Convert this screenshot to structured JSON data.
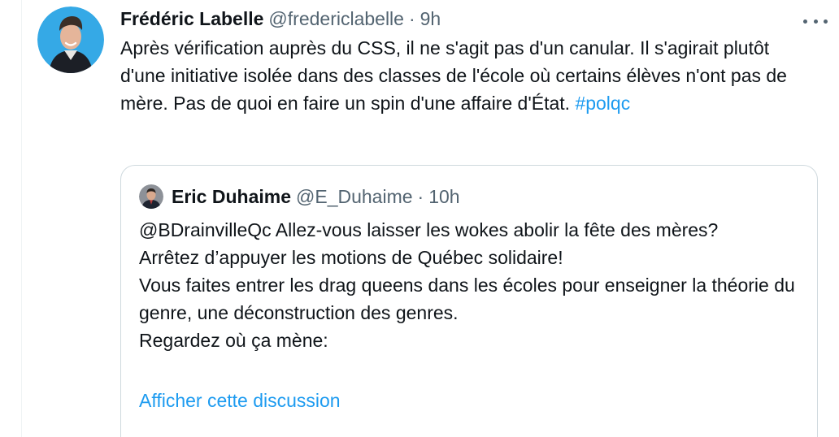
{
  "tweet": {
    "author_name": "Frédéric Labelle",
    "author_handle": "@fredericlabelle",
    "separator": "·",
    "timestamp": "9h",
    "text": "Après vérification auprès du CSS, il ne s'agit pas d'un canular. Il s'agirait plutôt d'une initiative isolée dans des classes de l'école où certains élèves n'ont pas de mère. Pas de quoi en faire un spin d'une affaire d'État.",
    "hashtag": "#polqc",
    "more_icon": "more-horizontal-icon"
  },
  "quoted_tweet": {
    "author_name": "Eric Duhaime",
    "author_handle": "@E_Duhaime",
    "separator": "·",
    "timestamp": "10h",
    "lines": [
      "@BDrainvilleQc Allez-vous laisser les wokes abolir la fête des mères?",
      "Arrêtez d’appuyer les motions de Québec solidaire!",
      "Vous faites entrer les drag queens dans les écoles pour enseigner la théorie du genre, une déconstruction des genres.",
      "Regardez où ça mène:"
    ],
    "show_thread_label": "Afficher cette discussion"
  },
  "colors": {
    "link": "#1d9bf0",
    "secondary_text": "#536471",
    "border": "#cfd9de"
  }
}
